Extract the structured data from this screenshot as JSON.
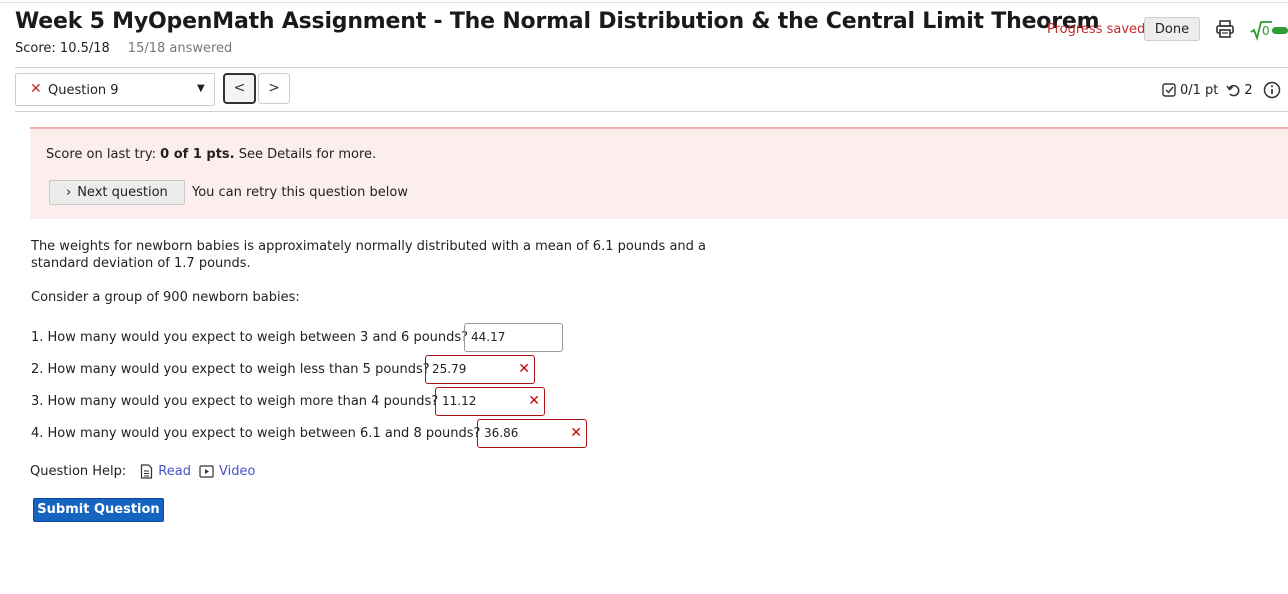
{
  "header": {
    "title": "Week 5 MyOpenMath Assignment - The Normal Distribution & the Central Limit Theorem",
    "score": "Score: 10.5/18",
    "answered": "15/18 answered",
    "progress_status": "Progress saved",
    "done_label": "Done",
    "icons": [
      "print-icon",
      "math-entry-icon"
    ]
  },
  "nav": {
    "question_selector": "Question 9",
    "question_status": "incorrect",
    "prev_label": "<",
    "next_label": ">",
    "points": "0/1 pt",
    "retries": "2"
  },
  "alert": {
    "prefix": "Score on last try: ",
    "score": "0 of 1 pts.",
    "suffix": " See Details for more.",
    "next_question_label": "Next question",
    "retry_text": "You can retry this question below"
  },
  "question": {
    "intro": "The weights for newborn babies is approximately normally distributed with a mean of 6.1 pounds and a standard deviation of 1.7 pounds.",
    "consider": "Consider a group of 900 newborn babies:",
    "parts": [
      {
        "text": "1. How many would you expect to weigh between 3 and 6 pounds?",
        "value": "44.17",
        "status": "unmarked"
      },
      {
        "text": "2. How many would you expect to weigh less than 5 pounds?",
        "value": "25.79",
        "status": "incorrect"
      },
      {
        "text": "3. How many would you expect to weigh more than 4 pounds?",
        "value": "11.12",
        "status": "incorrect"
      },
      {
        "text": "4. How many would you expect to weigh between 6.1 and 8 pounds?",
        "value": "36.86",
        "status": "incorrect"
      }
    ]
  },
  "help": {
    "label": "Question Help:",
    "read": "Read",
    "video": "Video"
  },
  "submit_label": "Submit Question",
  "colors": {
    "error": "#c62828",
    "link": "#4a51c9",
    "primary": "#1565c0",
    "alert_bg": "#fdeeee"
  }
}
